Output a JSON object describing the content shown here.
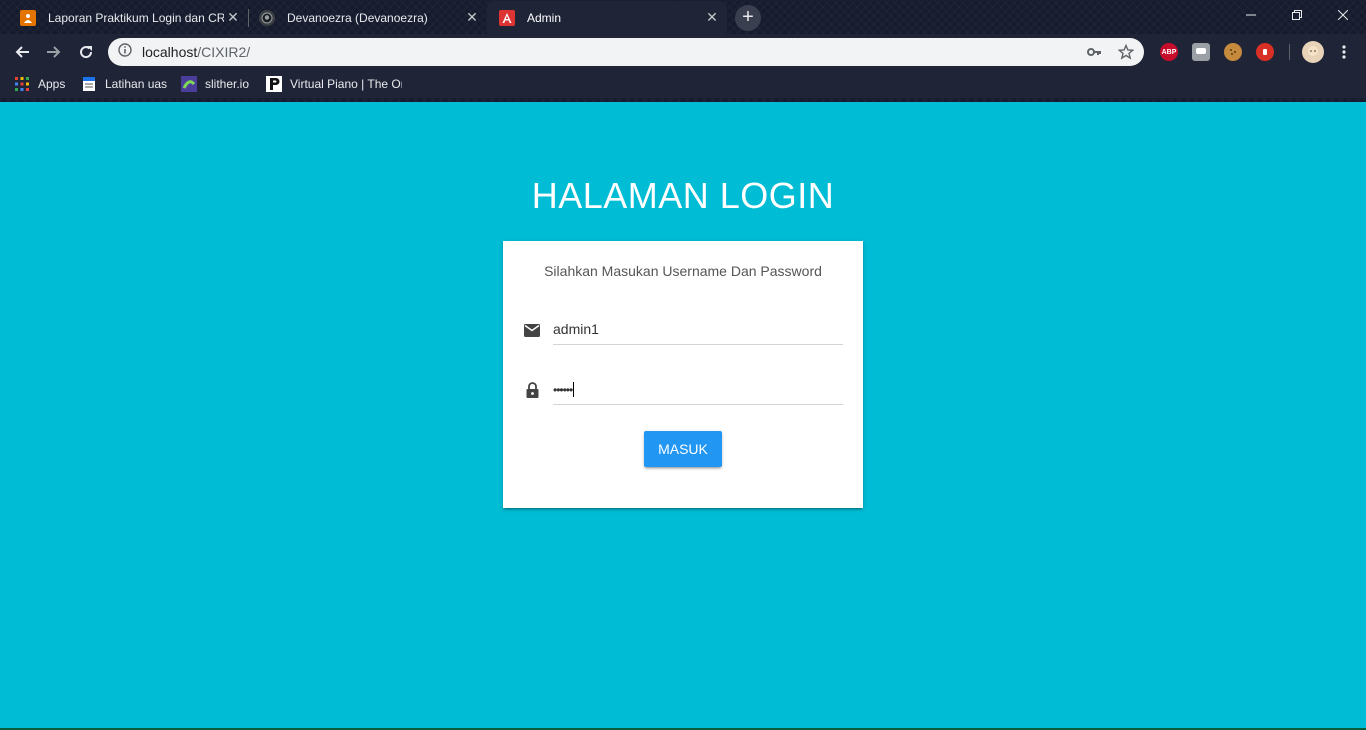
{
  "browser": {
    "tabs": [
      {
        "title": "Laporan Praktikum Login dan CR",
        "favicon": "person-icon",
        "favicon_color": "#e37400",
        "active": false
      },
      {
        "title": "Devanoezra (Devanoezra)",
        "favicon": "github-icon",
        "favicon_color": "#3c4043",
        "active": false
      },
      {
        "title": "Admin",
        "favicon": "angular-icon",
        "favicon_color": "#dd3333",
        "active": true
      }
    ],
    "close_glyph": "✕",
    "new_tab_glyph": "+",
    "window_controls": {
      "minimize": "—",
      "restore": "❐",
      "close": "✕"
    },
    "address": {
      "host": "localhost",
      "path": "/CIXIR2/"
    },
    "extensions": [
      {
        "name": "adblock-plus-icon",
        "label": "ABP",
        "color": "#c70d2c"
      },
      {
        "name": "chat-extension-icon",
        "label": "",
        "color": "#9aa0a6"
      },
      {
        "name": "cookie-extension-icon",
        "label": "",
        "color": "#c68a3c"
      },
      {
        "name": "stop-extension-icon",
        "label": "",
        "color": "#d93025"
      }
    ],
    "bookmarks": [
      {
        "label": "Apps",
        "icon": "apps-grid-icon"
      },
      {
        "label": "Latihan uas",
        "icon": "document-icon"
      },
      {
        "label": "slither.io",
        "icon": "slither-icon"
      },
      {
        "label": "Virtual Piano | The Or",
        "icon": "piano-p-icon"
      }
    ]
  },
  "page": {
    "background": "#00bcd4",
    "title": "HALAMAN LOGIN",
    "card": {
      "message": "Silahkan Masukan Username Dan Password",
      "username_value": "admin1",
      "password_mask": "••••••",
      "button_label": "MASUK",
      "button_color": "#2196f3"
    }
  }
}
